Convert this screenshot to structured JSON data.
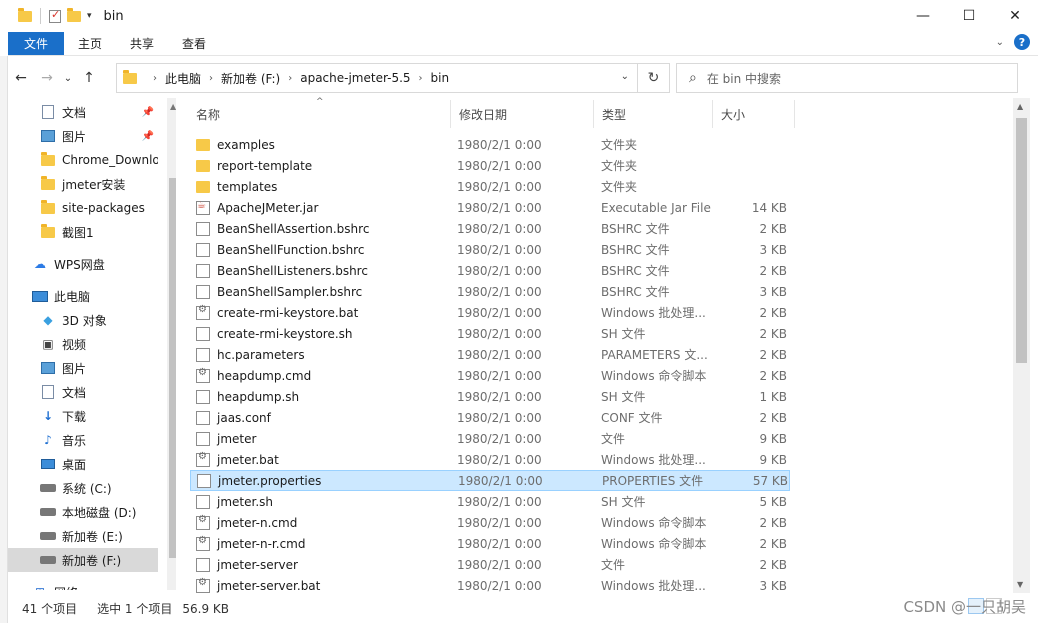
{
  "window": {
    "title": "bin"
  },
  "ribbon": {
    "tabs": [
      "文件",
      "主页",
      "共享",
      "查看"
    ]
  },
  "address": {
    "crumbs": [
      "此电脑",
      "新加卷 (F:)",
      "apache-jmeter-5.5",
      "bin"
    ],
    "search_placeholder": "在 bin 中搜索"
  },
  "nav": {
    "items": [
      {
        "label": "文档",
        "icon": "document-icon",
        "pinned": true
      },
      {
        "label": "图片",
        "icon": "picture-icon",
        "pinned": true
      },
      {
        "label": "Chrome_Downloads",
        "icon": "folder-icon"
      },
      {
        "label": "jmeter安装",
        "icon": "folder-icon"
      },
      {
        "label": "site-packages",
        "icon": "folder-icon"
      },
      {
        "label": "截图1",
        "icon": "folder-icon"
      },
      {
        "label": "WPS网盘",
        "icon": "cloud-icon"
      },
      {
        "label": "此电脑",
        "icon": "computer-icon"
      },
      {
        "label": "3D 对象",
        "icon": "3d-objects-icon"
      },
      {
        "label": "视频",
        "icon": "video-icon"
      },
      {
        "label": "图片",
        "icon": "picture-icon"
      },
      {
        "label": "文档",
        "icon": "document-icon"
      },
      {
        "label": "下载",
        "icon": "download-icon"
      },
      {
        "label": "音乐",
        "icon": "music-icon"
      },
      {
        "label": "桌面",
        "icon": "desktop-icon"
      },
      {
        "label": "系统 (C:)",
        "icon": "drive-icon"
      },
      {
        "label": "本地磁盘 (D:)",
        "icon": "drive-icon"
      },
      {
        "label": "新加卷 (E:)",
        "icon": "drive-icon"
      },
      {
        "label": "新加卷 (F:)",
        "icon": "drive-icon",
        "selected": true
      },
      {
        "label": "网络",
        "icon": "network-icon"
      }
    ]
  },
  "columns": {
    "name": "名称",
    "date": "修改日期",
    "type": "类型",
    "size": "大小"
  },
  "files": [
    {
      "name": "examples",
      "date": "1980/2/1 0:00",
      "type": "文件夹",
      "size": "",
      "icon": "folder"
    },
    {
      "name": "report-template",
      "date": "1980/2/1 0:00",
      "type": "文件夹",
      "size": "",
      "icon": "folder"
    },
    {
      "name": "templates",
      "date": "1980/2/1 0:00",
      "type": "文件夹",
      "size": "",
      "icon": "folder"
    },
    {
      "name": "ApacheJMeter.jar",
      "date": "1980/2/1 0:00",
      "type": "Executable Jar File",
      "size": "14 KB",
      "icon": "jar"
    },
    {
      "name": "BeanShellAssertion.bshrc",
      "date": "1980/2/1 0:00",
      "type": "BSHRC 文件",
      "size": "2 KB",
      "icon": "file"
    },
    {
      "name": "BeanShellFunction.bshrc",
      "date": "1980/2/1 0:00",
      "type": "BSHRC 文件",
      "size": "3 KB",
      "icon": "file"
    },
    {
      "name": "BeanShellListeners.bshrc",
      "date": "1980/2/1 0:00",
      "type": "BSHRC 文件",
      "size": "2 KB",
      "icon": "file"
    },
    {
      "name": "BeanShellSampler.bshrc",
      "date": "1980/2/1 0:00",
      "type": "BSHRC 文件",
      "size": "3 KB",
      "icon": "file"
    },
    {
      "name": "create-rmi-keystore.bat",
      "date": "1980/2/1 0:00",
      "type": "Windows 批处理...",
      "size": "2 KB",
      "icon": "bat"
    },
    {
      "name": "create-rmi-keystore.sh",
      "date": "1980/2/1 0:00",
      "type": "SH 文件",
      "size": "2 KB",
      "icon": "file"
    },
    {
      "name": "hc.parameters",
      "date": "1980/2/1 0:00",
      "type": "PARAMETERS 文...",
      "size": "2 KB",
      "icon": "file"
    },
    {
      "name": "heapdump.cmd",
      "date": "1980/2/1 0:00",
      "type": "Windows 命令脚本",
      "size": "2 KB",
      "icon": "bat"
    },
    {
      "name": "heapdump.sh",
      "date": "1980/2/1 0:00",
      "type": "SH 文件",
      "size": "1 KB",
      "icon": "file"
    },
    {
      "name": "jaas.conf",
      "date": "1980/2/1 0:00",
      "type": "CONF 文件",
      "size": "2 KB",
      "icon": "file"
    },
    {
      "name": "jmeter",
      "date": "1980/2/1 0:00",
      "type": "文件",
      "size": "9 KB",
      "icon": "file"
    },
    {
      "name": "jmeter.bat",
      "date": "1980/2/1 0:00",
      "type": "Windows 批处理...",
      "size": "9 KB",
      "icon": "bat"
    },
    {
      "name": "jmeter.properties",
      "date": "1980/2/1 0:00",
      "type": "PROPERTIES 文件",
      "size": "57 KB",
      "icon": "file",
      "selected": true
    },
    {
      "name": "jmeter.sh",
      "date": "1980/2/1 0:00",
      "type": "SH 文件",
      "size": "5 KB",
      "icon": "file"
    },
    {
      "name": "jmeter-n.cmd",
      "date": "1980/2/1 0:00",
      "type": "Windows 命令脚本",
      "size": "2 KB",
      "icon": "bat"
    },
    {
      "name": "jmeter-n-r.cmd",
      "date": "1980/2/1 0:00",
      "type": "Windows 命令脚本",
      "size": "2 KB",
      "icon": "bat"
    },
    {
      "name": "jmeter-server",
      "date": "1980/2/1 0:00",
      "type": "文件",
      "size": "2 KB",
      "icon": "file"
    },
    {
      "name": "jmeter-server.bat",
      "date": "1980/2/1 0:00",
      "type": "Windows 批处理...",
      "size": "3 KB",
      "icon": "bat"
    }
  ],
  "status": {
    "count": "41 个项目",
    "selected": "选中 1 个项目",
    "size": "56.9 KB"
  },
  "watermark": "CSDN @一只胡吴"
}
